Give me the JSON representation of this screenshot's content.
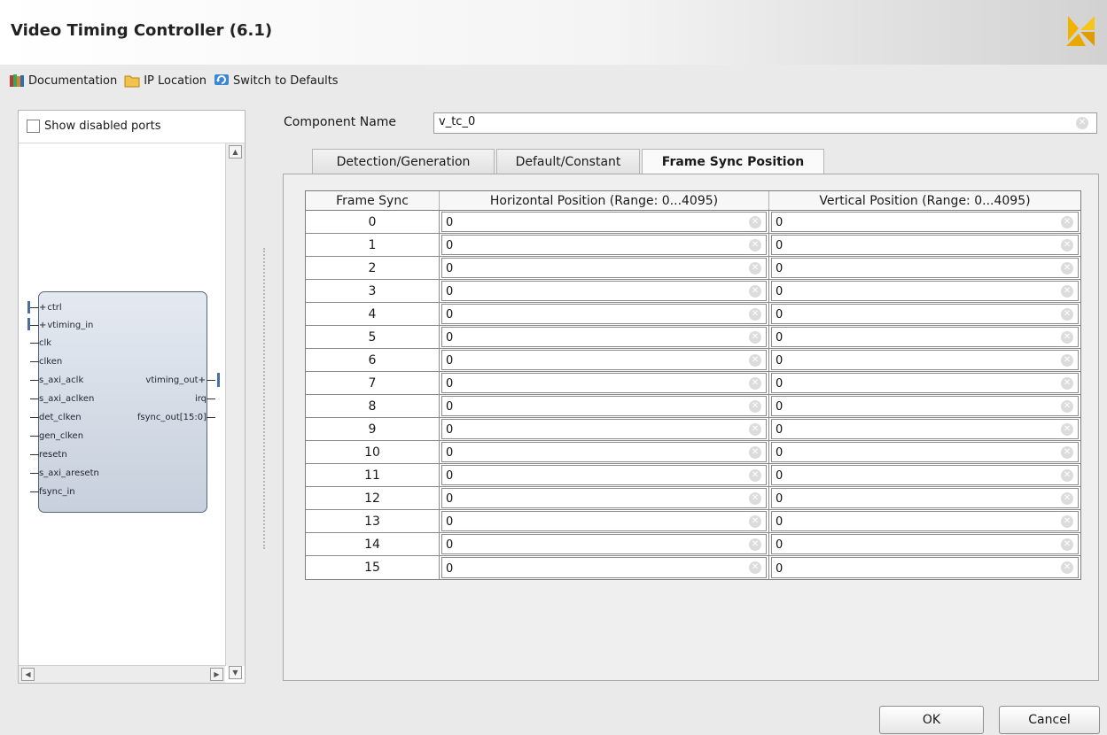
{
  "window": {
    "title": "Video Timing Controller (6.1)"
  },
  "toolbar": {
    "documentation": "Documentation",
    "ip_location": "IP Location",
    "switch_defaults": "Switch to Defaults"
  },
  "left_panel": {
    "show_disabled_ports": "Show disabled ports",
    "block": {
      "left_pins": [
        "ctrl",
        "vtiming_in",
        "clk",
        "clken",
        "s_axi_aclk",
        "s_axi_aclken",
        "det_clken",
        "gen_clken",
        "resetn",
        "s_axi_aresetn",
        "fsync_in"
      ],
      "right_pins": [
        "vtiming_out",
        "irq",
        "fsync_out[15:0]"
      ]
    }
  },
  "component": {
    "label": "Component Name",
    "value": "v_tc_0"
  },
  "tabs": [
    {
      "label": "Detection/Generation",
      "active": false
    },
    {
      "label": "Default/Constant",
      "active": false
    },
    {
      "label": "Frame Sync Position",
      "active": true
    }
  ],
  "grid": {
    "headers": [
      "Frame Sync",
      "Horizontal Position (Range: 0...4095)",
      "Vertical Position (Range: 0...4095)"
    ],
    "rows": [
      {
        "idx": "0",
        "h": "0",
        "v": "0"
      },
      {
        "idx": "1",
        "h": "0",
        "v": "0"
      },
      {
        "idx": "2",
        "h": "0",
        "v": "0"
      },
      {
        "idx": "3",
        "h": "0",
        "v": "0"
      },
      {
        "idx": "4",
        "h": "0",
        "v": "0"
      },
      {
        "idx": "5",
        "h": "0",
        "v": "0"
      },
      {
        "idx": "6",
        "h": "0",
        "v": "0"
      },
      {
        "idx": "7",
        "h": "0",
        "v": "0"
      },
      {
        "idx": "8",
        "h": "0",
        "v": "0"
      },
      {
        "idx": "9",
        "h": "0",
        "v": "0"
      },
      {
        "idx": "10",
        "h": "0",
        "v": "0"
      },
      {
        "idx": "11",
        "h": "0",
        "v": "0"
      },
      {
        "idx": "12",
        "h": "0",
        "v": "0"
      },
      {
        "idx": "13",
        "h": "0",
        "v": "0"
      },
      {
        "idx": "14",
        "h": "0",
        "v": "0"
      },
      {
        "idx": "15",
        "h": "0",
        "v": "0"
      }
    ]
  },
  "buttons": {
    "ok": "OK",
    "cancel": "Cancel"
  },
  "icons": {
    "documentation": "books-icon",
    "ip_location": "folder-icon",
    "switch_defaults": "refresh-icon",
    "clear": "clear-icon",
    "logo": "xilinx-logo-icon"
  },
  "colors": {
    "accent": "#4a6fa5",
    "logo": "#f0b400"
  }
}
